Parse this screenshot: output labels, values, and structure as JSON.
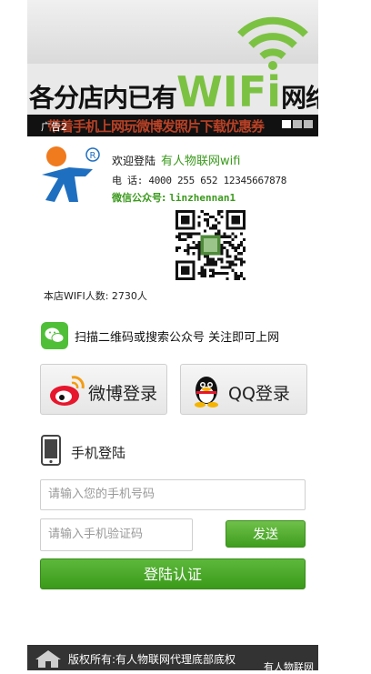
{
  "banner": {
    "headline_left": "各分店内已有",
    "headline_wifi": "WIFi",
    "headline_right": "网络",
    "strip_text": "带着手机上网玩微博发照片下载优惠券",
    "ad_label": "广告2"
  },
  "info": {
    "welcome_prefix": "欢迎登陆",
    "brand": "有人物联网wifi",
    "phone_label": "电 话:",
    "phone_value": "4000 255 652 12345667878",
    "wechat_label": "微信公众号:",
    "wechat_value": "linzhennan1",
    "users_text": "本店WIFI人数: 2730人"
  },
  "scan": {
    "tip": "扫描二维码或搜索公众号 关注即可上网"
  },
  "social": {
    "weibo_label": "微博登录",
    "qq_label": "QQ登录"
  },
  "phone_login": {
    "title": "手机登陆",
    "phone_placeholder": "请输入您的手机号码",
    "code_placeholder": "请输入手机验证码",
    "send_label": "发送",
    "submit_label": "登陆认证"
  },
  "footer": {
    "copyright": "版权所有:有人物联网代理底部底权",
    "brand": "有人物联网"
  },
  "colors": {
    "green": "#4fb52c",
    "brand_text": "#3a9a1c",
    "footer_bg": "#333333"
  },
  "icons": [
    "wifi-logo-icon",
    "usr-logo-icon",
    "qr-code-icon",
    "wechat-icon",
    "weibo-icon",
    "qq-icon",
    "mobile-phone-icon",
    "home-icon"
  ]
}
